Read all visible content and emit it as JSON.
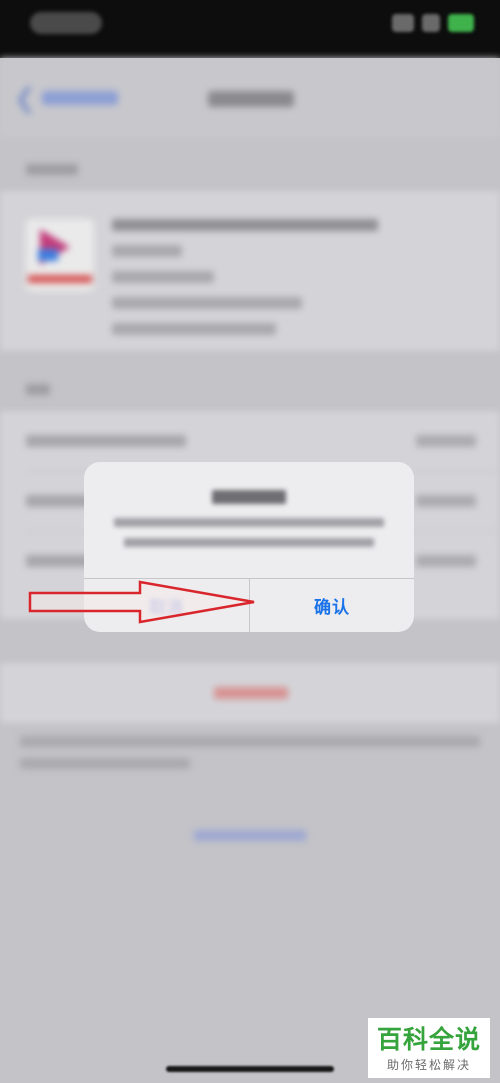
{
  "dialog": {
    "confirm_label": "确认",
    "cancel_label": "取消"
  },
  "watermark": {
    "brand": "百科全说",
    "slogan": "助你轻松解决"
  },
  "colors": {
    "confirm_button": "#1a73e8",
    "annotation_arrow": "#d9262c",
    "watermark_green": "#36a43c"
  },
  "icons": {
    "back": "chevron-left-icon",
    "annotation": "arrow-right-icon"
  }
}
